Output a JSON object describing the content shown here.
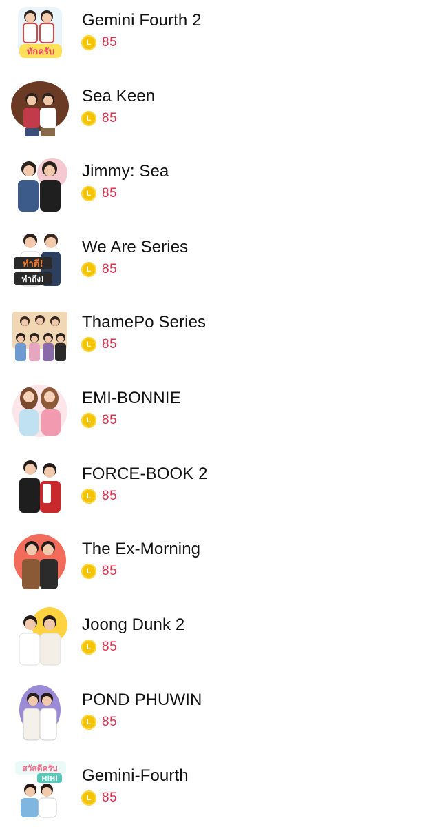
{
  "items": [
    {
      "title": "Gemini Fourth 2",
      "price": "85",
      "coin_letter": "L",
      "thumb_icon": "sticker-thumbnail-icon",
      "badge_text": "ทักครับ",
      "bg": "#ffffff",
      "accent": "#5aa9e6"
    },
    {
      "title": "Sea Keen",
      "price": "85",
      "coin_letter": "L",
      "thumb_icon": "sticker-thumbnail-icon",
      "badge_text": "",
      "bg": "#6b3a24",
      "accent": "#c23b4a"
    },
    {
      "title": "Jimmy: Sea",
      "price": "85",
      "coin_letter": "L",
      "thumb_icon": "sticker-thumbnail-icon",
      "badge_text": "",
      "bg": "#f4c9cf",
      "accent": "#3d5b8a"
    },
    {
      "title": "We Are Series",
      "price": "85",
      "coin_letter": "L",
      "thumb_icon": "sticker-thumbnail-icon",
      "badge_text": "ทำดี! ทำถึง!",
      "bg": "#ffffff",
      "accent": "#e2672a"
    },
    {
      "title": "ThamePo Series",
      "price": "85",
      "coin_letter": "L",
      "thumb_icon": "sticker-thumbnail-icon",
      "badge_text": "",
      "bg": "#f2d7b4",
      "accent": "#8a6aa8"
    },
    {
      "title": "EMI-BONNIE",
      "price": "85",
      "coin_letter": "L",
      "thumb_icon": "sticker-thumbnail-icon",
      "badge_text": "",
      "bg": "#fde6ea",
      "accent": "#f29bb0"
    },
    {
      "title": "FORCE-BOOK 2",
      "price": "85",
      "coin_letter": "L",
      "thumb_icon": "sticker-thumbnail-icon",
      "badge_text": "",
      "bg": "#ffffff",
      "accent": "#c9282d"
    },
    {
      "title": "The Ex-Morning",
      "price": "85",
      "coin_letter": "L",
      "thumb_icon": "sticker-thumbnail-icon",
      "badge_text": "",
      "bg": "#f26b5b",
      "accent": "#2b2b2b"
    },
    {
      "title": "Joong Dunk 2",
      "price": "85",
      "coin_letter": "L",
      "thumb_icon": "sticker-thumbnail-icon",
      "badge_text": "",
      "bg": "#ffd23f",
      "accent": "#f3efe6"
    },
    {
      "title": "POND PHUWIN",
      "price": "85",
      "coin_letter": "L",
      "thumb_icon": "sticker-thumbnail-icon",
      "badge_text": "",
      "bg": "#9b8ad6",
      "accent": "#f4f1ea"
    },
    {
      "title": "Gemini-Fourth",
      "price": "85",
      "coin_letter": "L",
      "thumb_icon": "sticker-thumbnail-icon",
      "badge_text": "สวัสดีครับ HiHi",
      "bg": "#ffffff",
      "accent": "#57c7b8"
    }
  ]
}
